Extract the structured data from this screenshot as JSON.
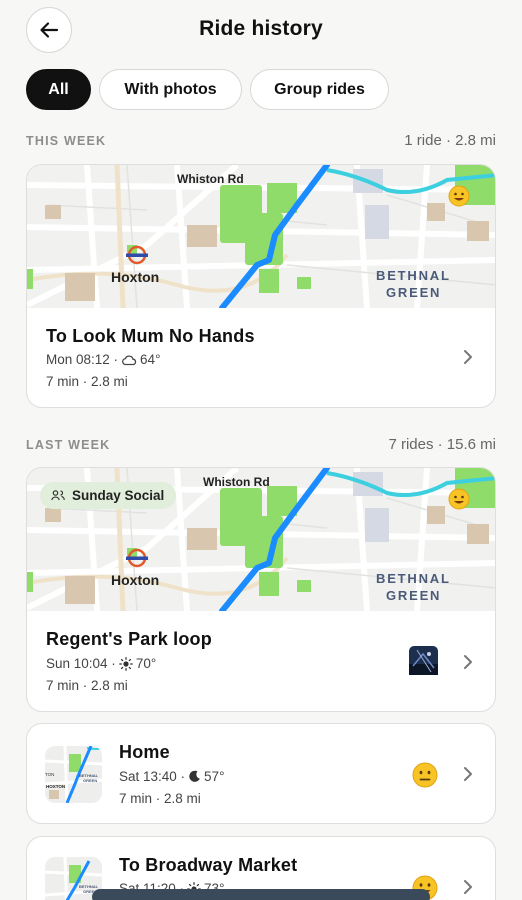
{
  "header": {
    "title": "Ride history"
  },
  "filters": [
    {
      "label": "All",
      "active": true
    },
    {
      "label": "With photos",
      "active": false
    },
    {
      "label": "Group rides",
      "active": false
    }
  ],
  "sections": [
    {
      "label": "THIS WEEK",
      "meta": "1 ride · 2.8 mi"
    },
    {
      "label": "LAST WEEK",
      "meta": "7 rides · 15.6 mi"
    }
  ],
  "map_labels": {
    "road": "Whiston Rd",
    "station": "Hoxton",
    "area_line1": "BETHNAL",
    "area_line2": "GREEN"
  },
  "rides": [
    {
      "name": "To Look Mum No Hands",
      "time": "Mon 08:12 ·",
      "weather_icon": "cloud-icon",
      "temp": "64°",
      "stats": "7 min · 2.8 mi",
      "mood": "happy"
    },
    {
      "name": "Regent's Park loop",
      "badge": "Sunday Social",
      "time": "Sun 10:04 ·",
      "weather_icon": "sun-icon",
      "temp": "70°",
      "stats": "7 min · 2.8 mi",
      "mood": "happy",
      "has_photo": true
    },
    {
      "name": "Home",
      "time": "Sat 13:40 ·",
      "weather_icon": "moon-icon",
      "temp": "57°",
      "stats": "7 min · 2.8 mi",
      "mood": "neutral"
    },
    {
      "name": "To Broadway Market",
      "time": "Sat 11:20 ·",
      "weather_icon": "sun-icon",
      "temp": "73°",
      "stats": "",
      "mood": "happy"
    }
  ],
  "colors": {
    "route": "#1a8cff",
    "canal": "#3ccfe0",
    "park": "#8fdc6a",
    "accent": "#111111",
    "badge_bg": "#e2eedc"
  }
}
